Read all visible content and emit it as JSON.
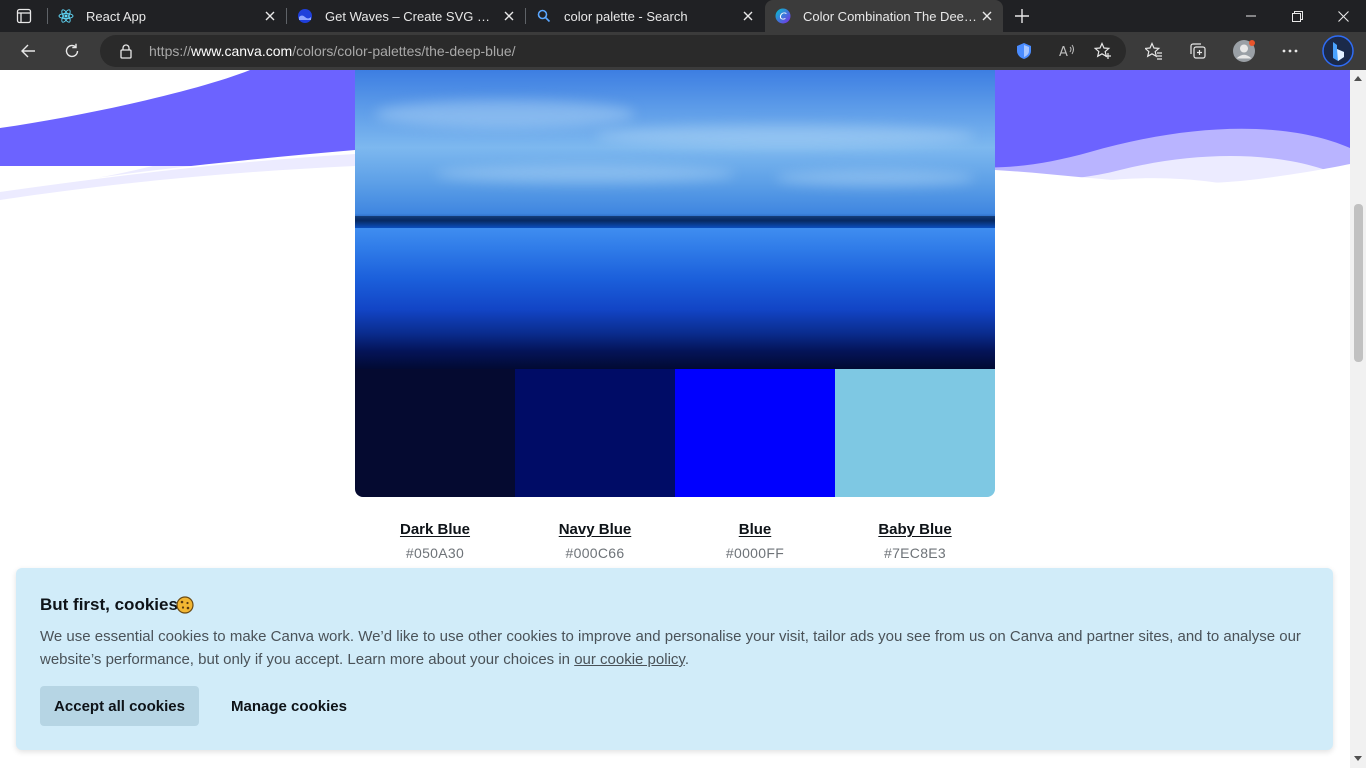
{
  "browser": {
    "tabs": [
      {
        "title": "React App",
        "favicon": "react-icon",
        "active": false
      },
      {
        "title": "Get Waves – Create SVG waves for your next design",
        "favicon": "waves-icon",
        "active": false
      },
      {
        "title": "color palette - Search",
        "favicon": "search-icon",
        "active": false
      },
      {
        "title": "Color Combination The Deep Blue",
        "favicon": "canva-icon",
        "active": true
      }
    ],
    "url_prefix": "https://",
    "url_host": "www.canva.com",
    "url_path": "/colors/color-palettes/the-deep-blue/",
    "extension_badge": "1",
    "accent_color": "#0078d4"
  },
  "palette": {
    "swatches": [
      {
        "name": "Dark Blue",
        "hex": "#050A30",
        "color": "#050A30"
      },
      {
        "name": "Navy Blue",
        "hex": "#000C66",
        "color": "#000C66"
      },
      {
        "name": "Blue",
        "hex": "#0000FF",
        "color": "#0000FF"
      },
      {
        "name": "Baby Blue",
        "hex": "#7EC8E3",
        "color": "#7EC8E3"
      }
    ],
    "wave_colors": [
      "#6c63ff",
      "#b9b4ff",
      "#ecebff"
    ]
  },
  "cookie_banner": {
    "title": "But first, cookies",
    "emoji": "cookie-icon",
    "text_before": "We use essential cookies to make Canva work. We’d like to use other cookies to improve and personalise your visit, tailor ads you see from us on Canva and partner sites, and to analyse our website’s performance, but only if you accept. Learn more about your choices in ",
    "link_text": "our cookie policy",
    "text_after": ".",
    "accept_label": "Accept all cookies",
    "manage_label": "Manage cookies",
    "background": "#d1ecf9"
  }
}
